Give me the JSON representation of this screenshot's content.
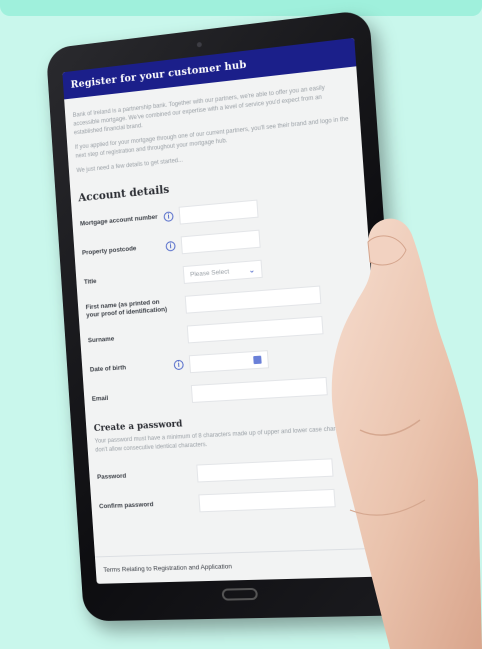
{
  "screen": {
    "header_title": "Register for your customer hub",
    "intro_paragraphs": [
      "Bank of Ireland is a partnership bank. Together with our partners, we're able to offer you an easily accessible mortgage. We've combined our expertise with a level of service you'd expect from an established financial brand.",
      "If you applied for your mortgage through one of our current partners, you'll see their brand and logo in the next step of registration and throughout your mortgage hub.",
      "We just need a few details to get started..."
    ],
    "account_details_title": "Account details",
    "fields": {
      "mortgage_account_number": "Mortgage account number",
      "property_postcode": "Property postcode",
      "title": "Title",
      "title_placeholder": "Please Select",
      "first_name": "First name (as printed on your proof of identification)",
      "surname": "Surname",
      "date_of_birth": "Date of birth",
      "email": "Email"
    },
    "create_password_title": "Create a password",
    "password_hint": "Your password must have a minimum of 8 characters made up of upper and lower case characters. We don't allow consecutive identical characters.",
    "password_label": "Password",
    "confirm_password_label": "Confirm password",
    "terms_link": "Terms Relating to Registration and Application"
  },
  "colors": {
    "background": "#c9f7ec",
    "header": "#1b1f8a",
    "accent": "#4b64c8"
  },
  "icons": {
    "info": "info-circle-icon",
    "chevron": "chevron-down-icon",
    "calendar": "calendar-icon"
  }
}
